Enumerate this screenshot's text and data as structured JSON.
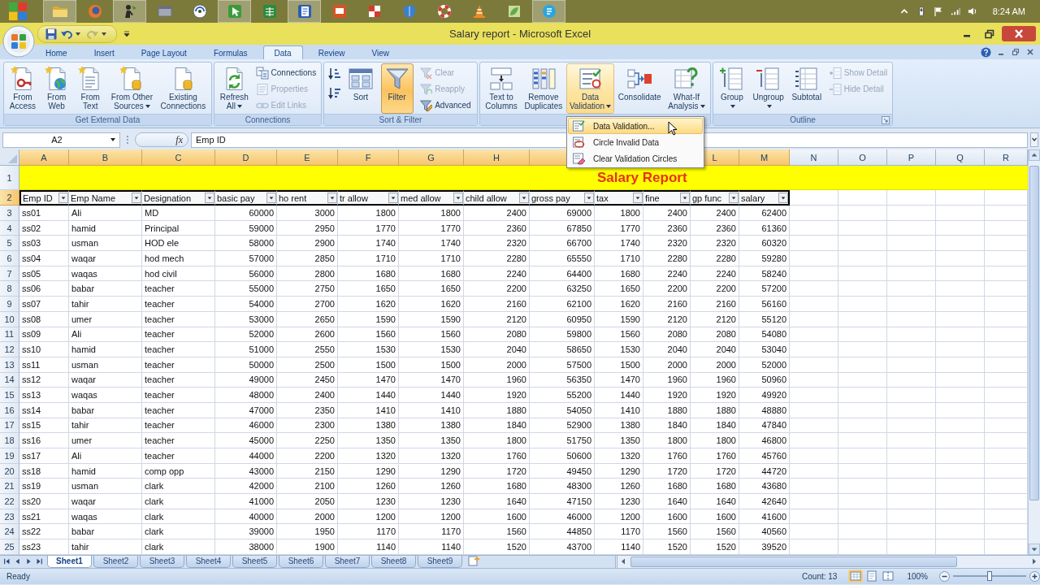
{
  "taskbar": {
    "apps": [
      {
        "kind": "folder",
        "running": true
      },
      {
        "kind": "globe",
        "running": false
      },
      {
        "kind": "person",
        "running": true
      },
      {
        "kind": "window",
        "running": false
      },
      {
        "kind": "disc",
        "running": false
      },
      {
        "kind": "pointer",
        "running": true
      },
      {
        "kind": "sheet",
        "running": false
      },
      {
        "kind": "document",
        "running": true
      },
      {
        "kind": "slides",
        "running": false
      },
      {
        "kind": "checkered",
        "running": false
      },
      {
        "kind": "shield",
        "running": false
      },
      {
        "kind": "lifebuoy",
        "running": false
      },
      {
        "kind": "cone",
        "running": false
      },
      {
        "kind": "leaf",
        "running": false
      },
      {
        "kind": "chat",
        "running": true
      }
    ],
    "clock": "8:24 AM"
  },
  "quick_access": [
    {
      "kind": "save",
      "disabled": false
    },
    {
      "kind": "undo",
      "disabled": false
    },
    {
      "kind": "redo",
      "disabled": true
    }
  ],
  "window": {
    "title": "Salary report - Microsoft Excel"
  },
  "ribbon": {
    "tabs": [
      {
        "label": "Home",
        "selected": false
      },
      {
        "label": "Insert",
        "selected": false
      },
      {
        "label": "Page Layout",
        "selected": false
      },
      {
        "label": "Formulas",
        "selected": false
      },
      {
        "label": "Data",
        "selected": true
      },
      {
        "label": "Review",
        "selected": false
      },
      {
        "label": "View",
        "selected": false
      }
    ],
    "groups": [
      {
        "label": "Get External Data",
        "items": [
          {
            "kind": "large",
            "lines": [
              "From",
              "Access"
            ],
            "dropdown": false,
            "on": false
          },
          {
            "kind": "large",
            "lines": [
              "From",
              "Web"
            ],
            "dropdown": false,
            "on": false
          },
          {
            "kind": "large",
            "lines": [
              "From",
              "Text"
            ],
            "dropdown": false,
            "on": false
          },
          {
            "kind": "large",
            "lines": [
              "From Other",
              "Sources"
            ],
            "dropdown": true,
            "expanded": false,
            "on": false
          },
          {
            "kind": "large",
            "lines": [
              "Existing",
              "Connections"
            ],
            "dropdown": false,
            "on": false
          }
        ]
      },
      {
        "label": "Connections",
        "items": [
          {
            "kind": "large",
            "lines": [
              "Refresh",
              "All"
            ],
            "dropdown": true,
            "expanded": false,
            "on": false
          },
          {
            "kind": "stack",
            "buttons": [
              {
                "label": "Connections",
                "disabled": false
              },
              {
                "label": "Properties",
                "disabled": true
              },
              {
                "label": "Edit Links",
                "disabled": true
              }
            ]
          }
        ]
      },
      {
        "label": "Sort & Filter",
        "items": [
          {
            "kind": "icon_pair"
          },
          {
            "kind": "large",
            "lines": [
              "Sort"
            ],
            "dropdown": false,
            "on": false
          },
          {
            "kind": "large",
            "lines": [
              "Filter"
            ],
            "dropdown": false,
            "on": true
          },
          {
            "kind": "stack",
            "buttons": [
              {
                "label": "Clear",
                "disabled": true
              },
              {
                "label": "Reapply",
                "disabled": true
              },
              {
                "label": "Advanced",
                "disabled": false
              }
            ]
          }
        ]
      },
      {
        "items": [
          {
            "kind": "large",
            "lines": [
              "Text to",
              "Columns"
            ],
            "dropdown": false,
            "on": false
          },
          {
            "kind": "large",
            "lines": [
              "Remove",
              "Duplicates"
            ],
            "dropdown": false,
            "on": false
          },
          {
            "kind": "large",
            "lines": [
              "Data",
              "Validation"
            ],
            "dropdown": true,
            "expanded": true,
            "on": true
          },
          {
            "kind": "large",
            "lines": [
              "Consolidate"
            ],
            "dropdown": false,
            "on": false
          },
          {
            "kind": "large",
            "lines": [
              "What-If",
              "Analysis"
            ],
            "dropdown": true,
            "expanded": false,
            "on": false
          }
        ]
      },
      {
        "label": "Outline",
        "launcher": true,
        "items": [
          {
            "kind": "large",
            "lines": [
              "Group"
            ],
            "dropdown": true,
            "expanded": false,
            "on": false
          },
          {
            "kind": "large",
            "lines": [
              "Ungroup"
            ],
            "dropdown": true,
            "expanded": false,
            "on": false
          },
          {
            "kind": "large",
            "lines": [
              "Subtotal"
            ],
            "dropdown": false,
            "on": false
          },
          {
            "kind": "stack",
            "buttons": [
              {
                "label": "Show Detail",
                "disabled": true
              },
              {
                "label": "Hide Detail",
                "disabled": true
              }
            ]
          }
        ]
      }
    ]
  },
  "menu": {
    "items": [
      {
        "label": "Data Validation...",
        "selected": true
      },
      {
        "label": "Circle Invalid Data",
        "selected": false
      },
      {
        "label": "Clear Validation Circles",
        "selected": false
      }
    ]
  },
  "formula_bar": {
    "name_box": "A2",
    "function_button": "fx",
    "value": "Emp ID"
  },
  "sheet": {
    "columns": [
      {
        "label": "A",
        "selected": true
      },
      {
        "label": "B",
        "selected": true
      },
      {
        "label": "C",
        "selected": true
      },
      {
        "label": "D",
        "selected": true
      },
      {
        "label": "E",
        "selected": true
      },
      {
        "label": "F",
        "selected": true
      },
      {
        "label": "G",
        "selected": true
      },
      {
        "label": "H",
        "selected": true
      },
      {
        "selected": true
      },
      {},
      {},
      {
        "label": "L",
        "selected": true
      },
      {
        "label": "M",
        "selected": true
      },
      {
        "label": "N",
        "selected": false
      },
      {
        "label": "O",
        "selected": false
      },
      {
        "label": "P",
        "selected": false
      },
      {
        "label": "Q",
        "selected": false
      },
      {
        "label": "R",
        "selected": false
      }
    ],
    "rows": [
      {
        "number": "1",
        "selected": false,
        "kind": "title",
        "title": "Salary Report"
      },
      {
        "number": "2",
        "selected": true,
        "kind": "header",
        "autofilter": true,
        "cells": [
          "Emp ID",
          "Emp Name",
          "Designation",
          "basic pay",
          "ho rent",
          "tr allow",
          "med allow",
          "child allow",
          "gross pay",
          "tax",
          "fine",
          "gp func",
          "salary"
        ]
      },
      {
        "number": "3",
        "selected": false,
        "kind": "data",
        "cells": [
          "ss01",
          "Ali",
          "MD",
          "60000",
          "3000",
          "1800",
          "1800",
          "2400",
          "69000",
          "1800",
          "2400",
          "2400",
          "62400"
        ]
      },
      {
        "number": "4",
        "selected": false,
        "kind": "data",
        "cells": [
          "ss02",
          "hamid",
          "Principal",
          "59000",
          "2950",
          "1770",
          "1770",
          "2360",
          "67850",
          "1770",
          "2360",
          "2360",
          "61360"
        ]
      },
      {
        "number": "5",
        "selected": false,
        "kind": "data",
        "cells": [
          "ss03",
          "usman",
          "HOD ele",
          "58000",
          "2900",
          "1740",
          "1740",
          "2320",
          "66700",
          "1740",
          "2320",
          "2320",
          "60320"
        ]
      },
      {
        "number": "6",
        "selected": false,
        "kind": "data",
        "cells": [
          "ss04",
          "waqar",
          "hod mech",
          "57000",
          "2850",
          "1710",
          "1710",
          "2280",
          "65550",
          "1710",
          "2280",
          "2280",
          "59280"
        ]
      },
      {
        "number": "7",
        "selected": false,
        "kind": "data",
        "cells": [
          "ss05",
          "waqas",
          "hod civil",
          "56000",
          "2800",
          "1680",
          "1680",
          "2240",
          "64400",
          "1680",
          "2240",
          "2240",
          "58240"
        ]
      },
      {
        "number": "8",
        "selected": false,
        "kind": "data",
        "cells": [
          "ss06",
          "babar",
          "teacher",
          "55000",
          "2750",
          "1650",
          "1650",
          "2200",
          "63250",
          "1650",
          "2200",
          "2200",
          "57200"
        ]
      },
      {
        "number": "9",
        "selected": false,
        "kind": "data",
        "cells": [
          "ss07",
          "tahir",
          "teacher",
          "54000",
          "2700",
          "1620",
          "1620",
          "2160",
          "62100",
          "1620",
          "2160",
          "2160",
          "56160"
        ]
      },
      {
        "number": "10",
        "selected": false,
        "kind": "data",
        "cells": [
          "ss08",
          "umer",
          "teacher",
          "53000",
          "2650",
          "1590",
          "1590",
          "2120",
          "60950",
          "1590",
          "2120",
          "2120",
          "55120"
        ]
      },
      {
        "number": "11",
        "selected": false,
        "kind": "data",
        "cells": [
          "ss09",
          "Ali",
          "teacher",
          "52000",
          "2600",
          "1560",
          "1560",
          "2080",
          "59800",
          "1560",
          "2080",
          "2080",
          "54080"
        ]
      },
      {
        "number": "12",
        "selected": false,
        "kind": "data",
        "cells": [
          "ss10",
          "hamid",
          "teacher",
          "51000",
          "2550",
          "1530",
          "1530",
          "2040",
          "58650",
          "1530",
          "2040",
          "2040",
          "53040"
        ]
      },
      {
        "number": "13",
        "selected": false,
        "kind": "data",
        "cells": [
          "ss11",
          "usman",
          "teacher",
          "50000",
          "2500",
          "1500",
          "1500",
          "2000",
          "57500",
          "1500",
          "2000",
          "2000",
          "52000"
        ]
      },
      {
        "number": "14",
        "selected": false,
        "kind": "data",
        "cells": [
          "ss12",
          "waqar",
          "teacher",
          "49000",
          "2450",
          "1470",
          "1470",
          "1960",
          "56350",
          "1470",
          "1960",
          "1960",
          "50960"
        ]
      },
      {
        "number": "15",
        "selected": false,
        "kind": "data",
        "cells": [
          "ss13",
          "waqas",
          "teacher",
          "48000",
          "2400",
          "1440",
          "1440",
          "1920",
          "55200",
          "1440",
          "1920",
          "1920",
          "49920"
        ]
      },
      {
        "number": "16",
        "selected": false,
        "kind": "data",
        "cells": [
          "ss14",
          "babar",
          "teacher",
          "47000",
          "2350",
          "1410",
          "1410",
          "1880",
          "54050",
          "1410",
          "1880",
          "1880",
          "48880"
        ]
      },
      {
        "number": "17",
        "selected": false,
        "kind": "data",
        "cells": [
          "ss15",
          "tahir",
          "teacher",
          "46000",
          "2300",
          "1380",
          "1380",
          "1840",
          "52900",
          "1380",
          "1840",
          "1840",
          "47840"
        ]
      },
      {
        "number": "18",
        "selected": false,
        "kind": "data",
        "cells": [
          "ss16",
          "umer",
          "teacher",
          "45000",
          "2250",
          "1350",
          "1350",
          "1800",
          "51750",
          "1350",
          "1800",
          "1800",
          "46800"
        ]
      },
      {
        "number": "19",
        "selected": false,
        "kind": "data",
        "cells": [
          "ss17",
          "Ali",
          "teacher",
          "44000",
          "2200",
          "1320",
          "1320",
          "1760",
          "50600",
          "1320",
          "1760",
          "1760",
          "45760"
        ]
      },
      {
        "number": "20",
        "selected": false,
        "kind": "data",
        "cells": [
          "ss18",
          "hamid",
          "comp opp",
          "43000",
          "2150",
          "1290",
          "1290",
          "1720",
          "49450",
          "1290",
          "1720",
          "1720",
          "44720"
        ]
      },
      {
        "number": "21",
        "selected": false,
        "kind": "data",
        "cells": [
          "ss19",
          "usman",
          "clark",
          "42000",
          "2100",
          "1260",
          "1260",
          "1680",
          "48300",
          "1260",
          "1680",
          "1680",
          "43680"
        ]
      },
      {
        "number": "22",
        "selected": false,
        "kind": "data",
        "cells": [
          "ss20",
          "waqar",
          "clark",
          "41000",
          "2050",
          "1230",
          "1230",
          "1640",
          "47150",
          "1230",
          "1640",
          "1640",
          "42640"
        ]
      },
      {
        "number": "23",
        "selected": false,
        "kind": "data",
        "cells": [
          "ss21",
          "waqas",
          "clark",
          "40000",
          "2000",
          "1200",
          "1200",
          "1600",
          "46000",
          "1200",
          "1600",
          "1600",
          "41600"
        ]
      },
      {
        "number": "24",
        "selected": false,
        "kind": "data",
        "cells": [
          "ss22",
          "babar",
          "clark",
          "39000",
          "1950",
          "1170",
          "1170",
          "1560",
          "44850",
          "1170",
          "1560",
          "1560",
          "40560"
        ]
      },
      {
        "number": "25",
        "selected": false,
        "kind": "data",
        "cells": [
          "ss23",
          "tahir",
          "clark",
          "38000",
          "1900",
          "1140",
          "1140",
          "1520",
          "43700",
          "1140",
          "1520",
          "1520",
          "39520"
        ]
      }
    ]
  },
  "sheet_tabs": [
    {
      "label": "Sheet1",
      "selected": true
    },
    {
      "label": "Sheet2",
      "selected": false
    },
    {
      "label": "Sheet3",
      "selected": false
    },
    {
      "label": "Sheet4",
      "selected": false
    },
    {
      "label": "Sheet5",
      "selected": false
    },
    {
      "label": "Sheet6",
      "selected": false
    },
    {
      "label": "Sheet7",
      "selected": false
    },
    {
      "label": "Sheet8",
      "selected": false
    },
    {
      "label": "Sheet9",
      "selected": false
    }
  ],
  "status_bar": {
    "mode": "Ready",
    "count": "Count: 13",
    "views": [
      {
        "kind": "normal",
        "selected": true
      },
      {
        "kind": "page_layout",
        "selected": false
      },
      {
        "kind": "page_break",
        "selected": false
      }
    ],
    "zoom": "100%",
    "zoom_slider": {
      "level": 0.5
    }
  }
}
